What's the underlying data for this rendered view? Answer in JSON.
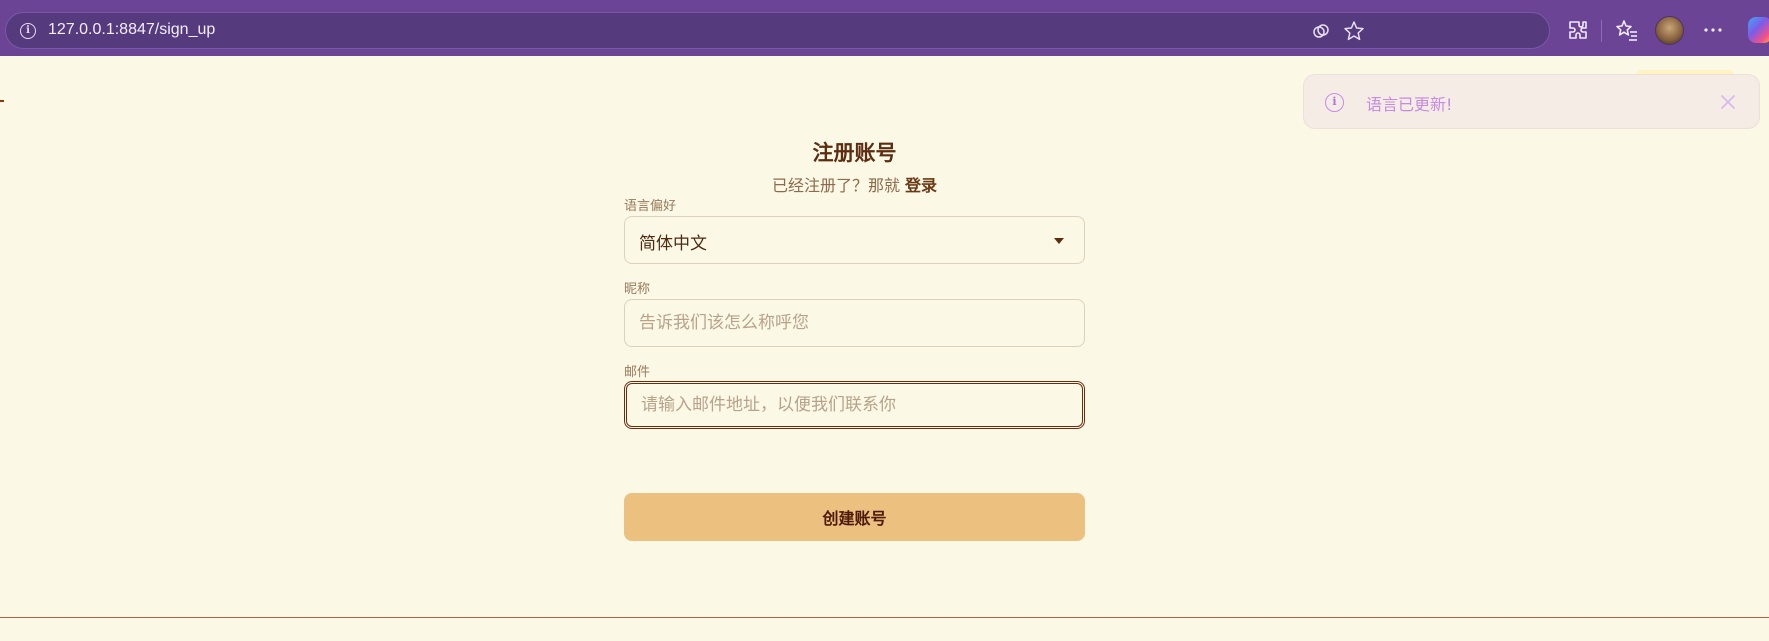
{
  "browser": {
    "url": "127.0.0.1:8847/sign_up",
    "icons": [
      "info-icon",
      "copilot-vision-icon",
      "favorite-star-icon",
      "extensions-icon",
      "favorites-list-icon",
      "profile-avatar",
      "more-menu-icon",
      "copilot-icon"
    ]
  },
  "form": {
    "title": "注册账号",
    "subtitle_prefix": "已经注册了？那就",
    "login_link": "登录",
    "language_label": "语言偏好",
    "language_value": "简体中文",
    "nickname_label": "昵称",
    "nickname_placeholder": "告诉我们该怎么称呼您",
    "email_label": "邮件",
    "email_placeholder": "请输入邮件地址，以便我们联系你",
    "submit_label": "创建账号"
  },
  "toast": {
    "message": "语言已更新!",
    "icon": "info-icon",
    "close_icon": "close-icon"
  },
  "colors": {
    "browser_frame": "#6b4496",
    "page_background": "#fbf8e6",
    "title": "#5c2d10",
    "submit_button": "#ecc07e",
    "toast_text": "#c58be0"
  }
}
